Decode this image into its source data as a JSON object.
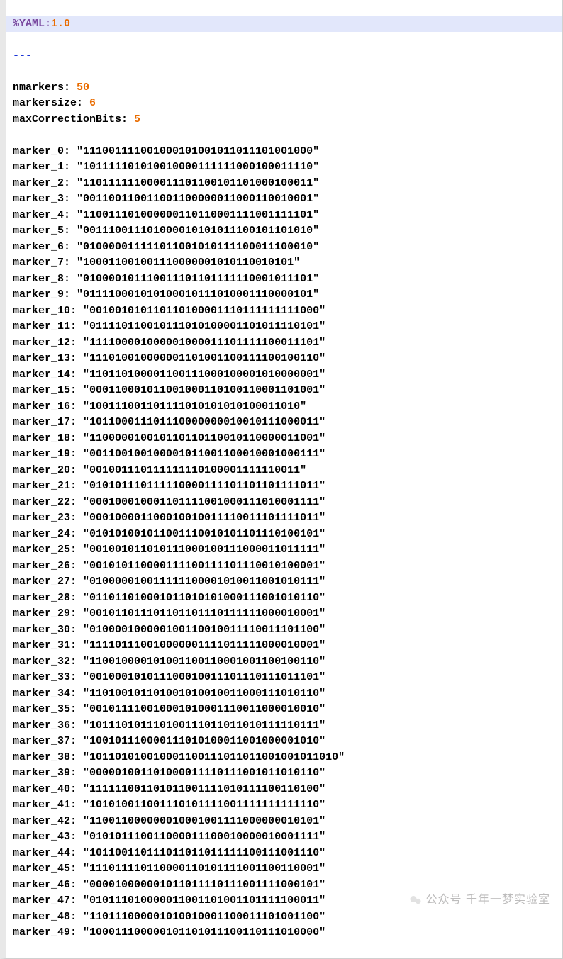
{
  "header": {
    "directive_label": "%YAML:",
    "directive_version": "1.0",
    "doc_marker": "---"
  },
  "meta": [
    {
      "key": "nmarkers",
      "value": "50"
    },
    {
      "key": "markersize",
      "value": "6"
    },
    {
      "key": "maxCorrectionBits",
      "value": "5"
    }
  ],
  "markers": [
    {
      "key": "marker_0",
      "value": "111001111001000101001011011101001000"
    },
    {
      "key": "marker_1",
      "value": "101111101010010000111111000100011110"
    },
    {
      "key": "marker_2",
      "value": "110111111000011101100101101000100011"
    },
    {
      "key": "marker_3",
      "value": "001100110011001100000011000110010001"
    },
    {
      "key": "marker_4",
      "value": "110011101000000110110001111001111101"
    },
    {
      "key": "marker_5",
      "value": "001110011101000010101011100101101010"
    },
    {
      "key": "marker_6",
      "value": "010000011111011001010111100011100010"
    },
    {
      "key": "marker_7",
      "value": "100011001001110000001010110010101"
    },
    {
      "key": "marker_8",
      "value": "010000101110011101101111110001011101"
    },
    {
      "key": "marker_9",
      "value": "011110001010100010111010001110000101"
    },
    {
      "key": "marker_10",
      "value": "001001010110110100001110111111111000"
    },
    {
      "key": "marker_11",
      "value": "011110110010111010100001101011110101"
    },
    {
      "key": "marker_12",
      "value": "111100001000001000011101111100011101"
    },
    {
      "key": "marker_13",
      "value": "111010010000001101001100111100100110"
    },
    {
      "key": "marker_14",
      "value": "110110100001100111000100001010000001"
    },
    {
      "key": "marker_15",
      "value": "000110001011001000110100110001101001"
    },
    {
      "key": "marker_16",
      "value": "100111001101111010101010100011010"
    },
    {
      "key": "marker_17",
      "value": "101100011101110000000010010111000011"
    },
    {
      "key": "marker_18",
      "value": "110000010010110110110010110000011001"
    },
    {
      "key": "marker_19",
      "value": "001100100100001011001100010001000111"
    },
    {
      "key": "marker_20",
      "value": "001001110111111110100001111110011"
    },
    {
      "key": "marker_21",
      "value": "010101110111110000111101101101111011"
    },
    {
      "key": "marker_22",
      "value": "000100010001101111001000111010001111"
    },
    {
      "key": "marker_23",
      "value": "000100001100010010011110011101111011"
    },
    {
      "key": "marker_24",
      "value": "010101001011001110010101101110100101"
    },
    {
      "key": "marker_25",
      "value": "001001011010111000100111000011011111"
    },
    {
      "key": "marker_26",
      "value": "001010110000111100111101110010100001"
    },
    {
      "key": "marker_27",
      "value": "010000010011111100001010011001010111"
    },
    {
      "key": "marker_28",
      "value": "011011010001011010101000111001010110"
    },
    {
      "key": "marker_29",
      "value": "001011011101101101110111111000010001"
    },
    {
      "key": "marker_30",
      "value": "010000100000100110010011110011101100"
    },
    {
      "key": "marker_31",
      "value": "111101110010000001111011111000010001"
    },
    {
      "key": "marker_32",
      "value": "110010000101001100110001001100100110"
    },
    {
      "key": "marker_33",
      "value": "001000101011100010011101110111011101"
    },
    {
      "key": "marker_34",
      "value": "110100101101001010010011000111010110"
    },
    {
      "key": "marker_35",
      "value": "001011110010001010001110011000010010"
    },
    {
      "key": "marker_36",
      "value": "101110101110100111011011010111110111"
    },
    {
      "key": "marker_37",
      "value": "100101110000111010100011001000001010"
    },
    {
      "key": "marker_38",
      "value": "101101010010001100111011011001001011010"
    },
    {
      "key": "marker_39",
      "value": "000001001101000011110111001011010110"
    },
    {
      "key": "marker_40",
      "value": "111111001101011001111010111100110100"
    },
    {
      "key": "marker_41",
      "value": "101010011001110101111001111111111110"
    },
    {
      "key": "marker_42",
      "value": "110011000000010001001111000000010101"
    },
    {
      "key": "marker_43",
      "value": "010101110011000011100010000010001111"
    },
    {
      "key": "marker_44",
      "value": "101100110111011011011111100111001110"
    },
    {
      "key": "marker_45",
      "value": "111011110110000110101111001100110001"
    },
    {
      "key": "marker_46",
      "value": "000010000001011011110111001111000101"
    },
    {
      "key": "marker_47",
      "value": "010111010000011001101001101111100011"
    },
    {
      "key": "marker_48",
      "value": "110111000001010010001100011101001100"
    },
    {
      "key": "marker_49",
      "value": "100011100000101101011100110111010000"
    }
  ],
  "watermark": {
    "text": "公众号  千年一梦实验室"
  }
}
